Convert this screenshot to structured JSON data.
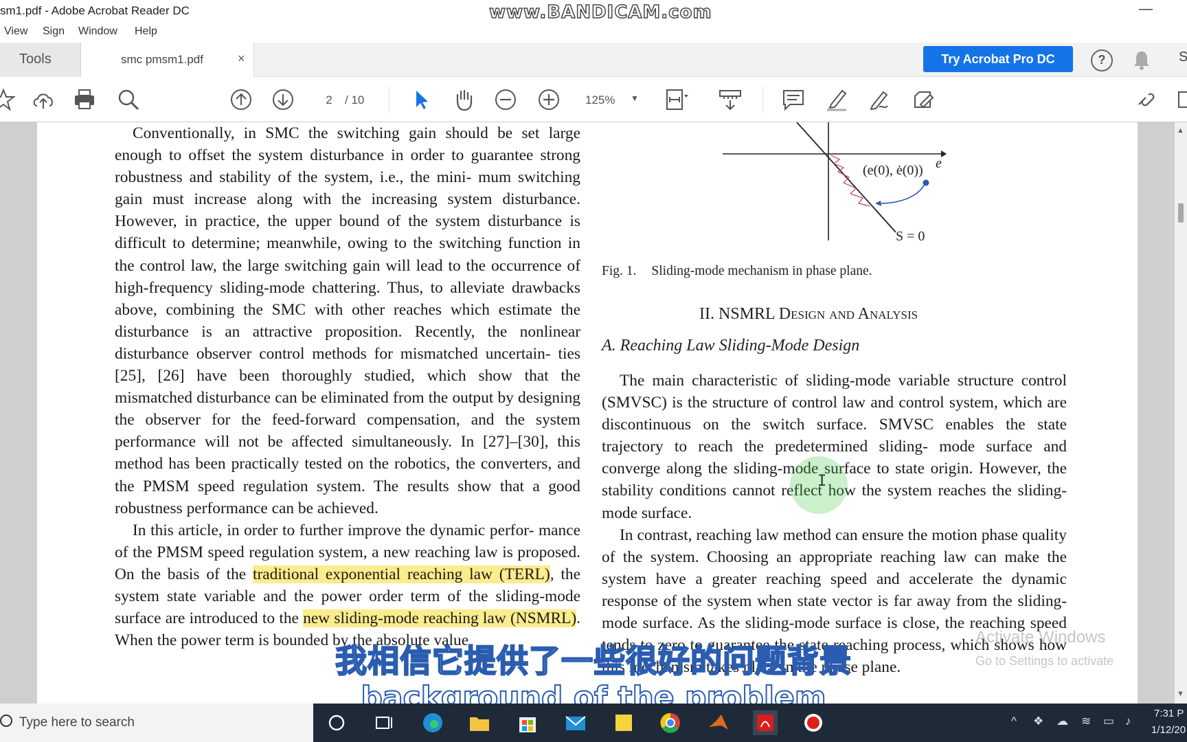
{
  "window": {
    "title": "sm1.pdf - Adobe Acrobat Reader DC",
    "watermark": "www.BANDICAM.com"
  },
  "menu": {
    "items": [
      "View",
      "Sign",
      "Window",
      "Help"
    ]
  },
  "tabs": {
    "tools": "Tools",
    "document": "smc pmsm1.pdf",
    "close": "×",
    "try_pro": "Try Acrobat Pro DC",
    "help": "?",
    "overflow": "S"
  },
  "toolbar": {
    "page_current": "2",
    "page_total": "/ 10",
    "zoom": "125%"
  },
  "document": {
    "left_column": [
      "Conventionally, in SMC the switching gain should be set large enough to offset the system disturbance in order to guarantee strong robustness and stability of the system, i.e., the mini- mum switching gain must increase along with the increasing system disturbance. However, in practice, the upper bound of the system disturbance is difficult to determine; meanwhile, owing to the switching function in the control law, the large switching gain will lead to the occurrence of high-frequency sliding-mode chattering. Thus, to alleviate drawbacks above, combining the SMC with other reaches which estimate the disturbance is an attractive proposition. Recently, the nonlinear disturbance observer control methods for mismatched uncertain- ties [25], [26] have been thoroughly studied, which show that the mismatched disturbance can be eliminated from the output by designing the observer for the feed-forward compensation, and the system performance will not be affected simultaneously. In [27]–[30], this method has been practically tested on the robotics, the converters, and the PMSM speed regulation system. The results show that a good robustness performance can be achieved."
    ],
    "left_p2_start": "In this article, in order to further improve the dynamic perfor- mance of the PMSM speed regulation system, a new reaching law is proposed. On the basis of the",
    "left_p2_hl1": "traditional exponential reaching law (TERL)",
    "left_p2_mid": ", the system state variable and the power order term of the sliding-mode surface are introduced to the",
    "left_p2_hl2": "new sliding-mode reaching law (NSMRL)",
    "left_p2_end": ". When the power term is bounded by the absolute value",
    "figure": {
      "axis_e": "e",
      "point_label": "(e(0), ė(0))",
      "surface_label": "S = 0"
    },
    "fig_caption_num": "Fig. 1.",
    "fig_caption_text": "Sliding-mode mechanism in phase plane.",
    "section_heading": "II. NSMRL Design and Analysis",
    "subsection_heading": "A. Reaching Law Sliding-Mode Design",
    "right_p1": "The main characteristic of sliding-mode variable structure control (SMVSC) is the structure of control law and control system, which are discontinuous on the switch surface. SMVSC enables the state trajectory to reach the predetermined sliding- mode surface and converge along the sliding-mode surface to state origin. However, the stability conditions cannot reflect how the system reaches the sliding-mode surface.",
    "right_p2": "In contrast, reaching law method can ensure the motion phase quality of the system. Choosing an appropriate reaching law can make the system have a greater reaching speed and accelerate the dynamic response of the system when state vector is far away from the sliding-mode surface. As the sliding-mode surface is close, the reaching speed tends to zero to guarantee the state reaching process, which shows how this mechanism takes place in the phase plane."
  },
  "overlay": {
    "activate_title": "Activate Windows",
    "activate_sub": "Go to Settings to activate",
    "subtitle_zh": "我相信它提供了一些很好的问题背景",
    "subtitle_en": "background of the problem"
  },
  "taskbar": {
    "search_placeholder": "Type here to search",
    "time": "7:31 P",
    "date": "1/12/20"
  }
}
